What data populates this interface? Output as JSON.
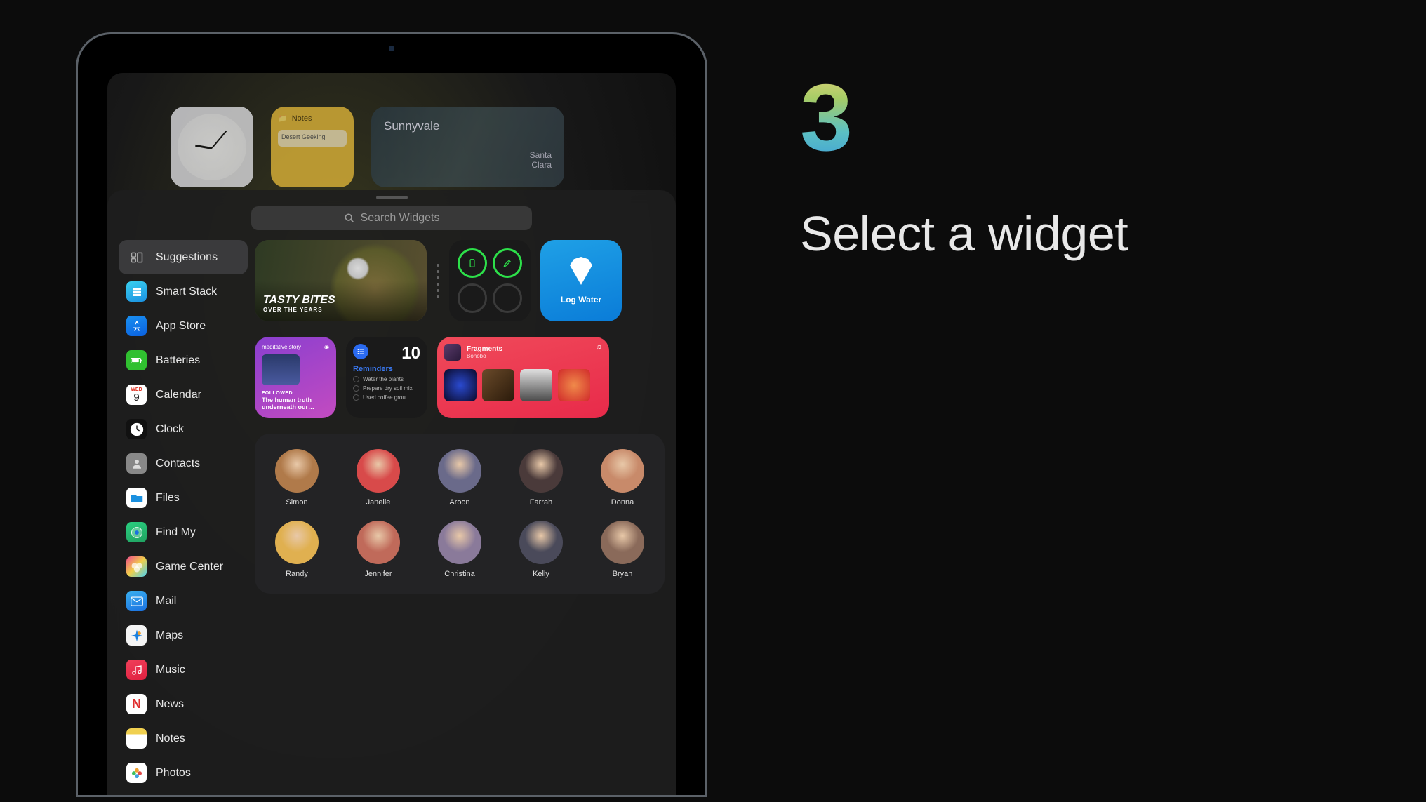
{
  "step": {
    "number": "3",
    "title": "Select a widget"
  },
  "background": {
    "notes": {
      "header": "Notes",
      "card": "Desert Geeking"
    },
    "map": {
      "city": "Sunnyvale",
      "label": "Santa\nClara"
    }
  },
  "search": {
    "placeholder": "Search Widgets"
  },
  "sidebar": [
    {
      "label": "Suggestions",
      "icon": "suggestions-icon",
      "cls": "ic-sugg",
      "selected": true
    },
    {
      "label": "Smart Stack",
      "icon": "smart-stack-icon",
      "cls": "ic-stack"
    },
    {
      "label": "App Store",
      "icon": "app-store-icon",
      "cls": "ic-store"
    },
    {
      "label": "Batteries",
      "icon": "batteries-icon",
      "cls": "ic-batt"
    },
    {
      "label": "Calendar",
      "icon": "calendar-icon",
      "cls": "ic-cal"
    },
    {
      "label": "Clock",
      "icon": "clock-icon",
      "cls": "ic-clock"
    },
    {
      "label": "Contacts",
      "icon": "contacts-icon",
      "cls": "ic-cont"
    },
    {
      "label": "Files",
      "icon": "files-icon",
      "cls": "ic-files"
    },
    {
      "label": "Find My",
      "icon": "find-my-icon",
      "cls": "ic-find"
    },
    {
      "label": "Game Center",
      "icon": "game-center-icon",
      "cls": "ic-gc"
    },
    {
      "label": "Mail",
      "icon": "mail-icon",
      "cls": "ic-mail"
    },
    {
      "label": "Maps",
      "icon": "maps-icon",
      "cls": "ic-maps"
    },
    {
      "label": "Music",
      "icon": "music-icon",
      "cls": "ic-music"
    },
    {
      "label": "News",
      "icon": "news-icon",
      "cls": "ic-news"
    },
    {
      "label": "Notes",
      "icon": "notes-icon",
      "cls": "ic-notes"
    },
    {
      "label": "Photos",
      "icon": "photos-icon",
      "cls": "ic-photos"
    }
  ],
  "widgets": {
    "tasty": {
      "title": "TASTY BITES",
      "subtitle": "OVER THE YEARS"
    },
    "water": {
      "label": "Log Water"
    },
    "podcast": {
      "app": "meditative story",
      "followed": "FOLLOWED",
      "title": "The human truth underneath our…"
    },
    "reminders": {
      "count": "10",
      "label": "Reminders",
      "items": [
        "Water the plants",
        "Prepare dry soil mix",
        "Used coffee grou…"
      ]
    },
    "music": {
      "track": "Fragments",
      "artist": "Bonobo"
    }
  },
  "contacts": {
    "row1": [
      "Simon",
      "Janelle",
      "Aroon",
      "Farrah",
      "Donna"
    ],
    "row2": [
      "Randy",
      "Jennifer",
      "Christina",
      "Kelly",
      "Bryan"
    ]
  },
  "avatarColors": {
    "row1": [
      "#b07a4a",
      "#d84a4a",
      "#6a6a8a",
      "#4a3a3a",
      "#c88a6a"
    ],
    "row2": [
      "#e0b050",
      "#c06a5a",
      "#8a7a9a",
      "#4a4a5a",
      "#8a6a5a"
    ]
  }
}
